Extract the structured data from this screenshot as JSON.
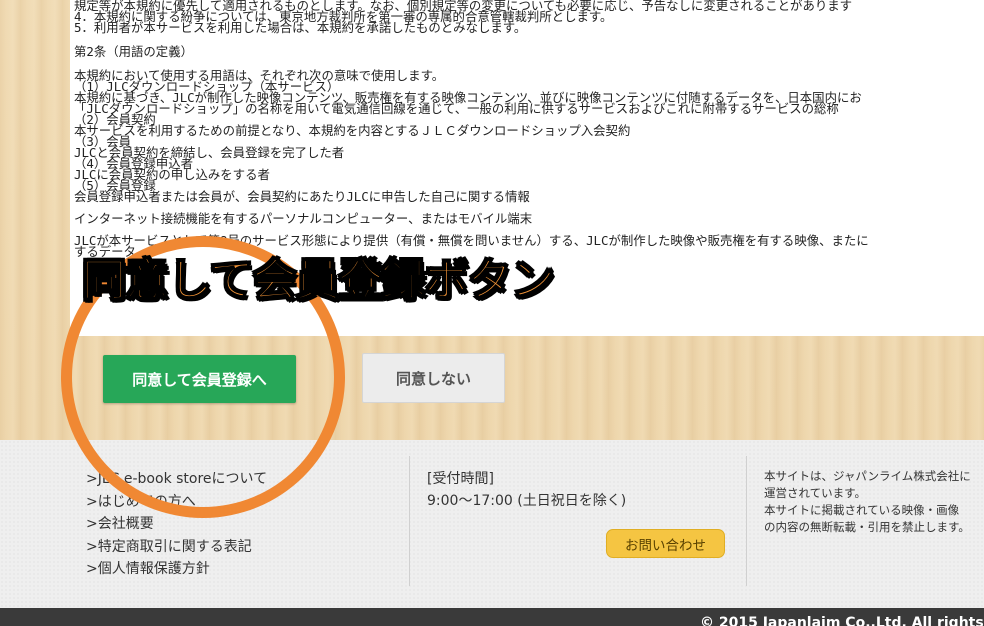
{
  "terms": {
    "lines": [
      "規定等が本規約に優先して適用されるものとします。なお、個別規定等の変更についても必要に応じ、予告なしに変更されることがあります",
      "4．本規約に関する紛争については、東京地方裁判所を第一審の専属的合意管轄裁判所とします。",
      "5．利用者が本サービスを利用した場合は、本規約を承諾したものとみなします。",
      "",
      "第2条（用語の定義）",
      "",
      "本規約において使用する用語は、それぞれ次の意味で使用します。",
      "（1）JLCダウンロードショップ（本サービス）",
      "本規約に基づき、JLCが制作した映像コンテンツ、販売権を有する映像コンテンツ、並びに映像コンテンツに付随するデータを、日本国内にお",
      "「JLCダウンロードショップ」の名称を用いて電気通信回線を通じて、一般の利用に供するサービスおよびこれに附帯するサービスの総称",
      "（2）会員契約",
      "本サービスを利用するための前提となり、本規約を内容とするＪＬＣダウンロードショップ入会契約",
      "（3）会員",
      "JLCと会員契約を締結し、会員登録を完了した者",
      "（4）会員登録申込者",
      "JLCに会員契約の申し込みをする者",
      "（5）会員登録",
      "会員登録申込者または会員が、会員契約にあたりJLCに申告した自己に関する情報",
      "",
      "インターネット接続機能を有するパーソナルコンピューター、またはモバイル端末",
      "",
      "JLCが本サービスとして第8号のサービス形態により提供（有償・無償を問いません）する、JLCが制作した映像や販売権を有する映像、またに",
      "するデータ"
    ]
  },
  "buttons": {
    "agree": "同意して会員登録へ",
    "disagree": "同意しない"
  },
  "annotation": {
    "label": "同意して会員登録ボタン",
    "color": "#f08833"
  },
  "footer": {
    "links": [
      ">JLC e-book storeについて",
      ">はじめての方へ",
      ">会社概要",
      ">特定商取引に関する表記",
      ">個人情報保護方針"
    ],
    "hours_title": "[受付時間]",
    "hours_value": "9:00～17:00 (土日祝日を除く)",
    "contact_button": "お問い合わせ",
    "notice_lines": [
      "本サイトは、ジャパンライム株式会社に",
      "運営されています。",
      "本サイトに掲載されている映像・画像",
      "の内容の無断転載・引用を禁止します。"
    ]
  },
  "copyright": "© 2015 Japanlaim Co.,Ltd. All rights",
  "colors": {
    "agree_button": "#27a758",
    "disagree_button": "#ececec",
    "contact_button": "#f5c542",
    "annotation": "#f08833",
    "copybar": "#3a3a3a"
  }
}
